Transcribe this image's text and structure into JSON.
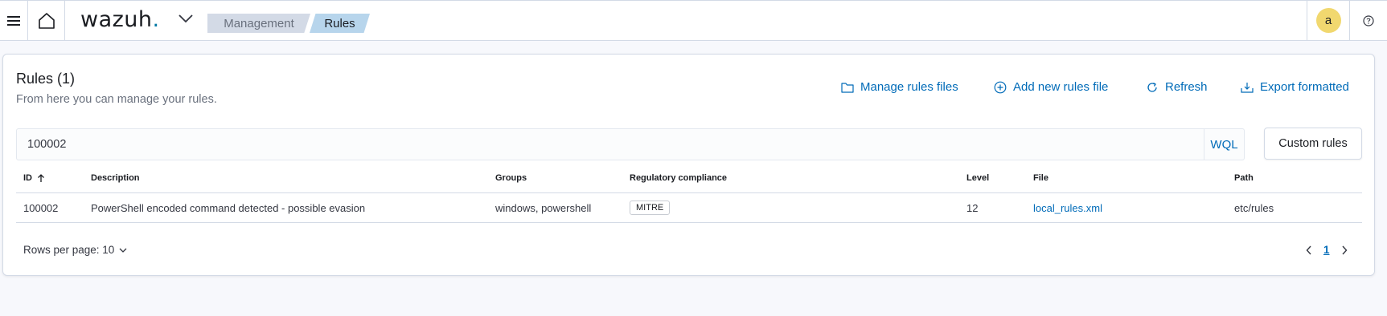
{
  "header": {
    "logo_text": "wazuh",
    "logo_dot": ".",
    "breadcrumbs": [
      "Management",
      "Rules"
    ],
    "user_initial": "a"
  },
  "panel": {
    "title": "Rules (1)",
    "subtitle": "From here you can manage your rules.",
    "actions": {
      "manage_rules_files": "Manage rules files",
      "add_new_rules_file": "Add new rules file",
      "refresh": "Refresh",
      "export_formatted": "Export formatted"
    },
    "search": {
      "value": "100002",
      "mode_label": "WQL"
    },
    "custom_rules_button": "Custom rules"
  },
  "table": {
    "columns": [
      "ID",
      "Description",
      "Groups",
      "Regulatory compliance",
      "Level",
      "File",
      "Path"
    ],
    "rows": [
      {
        "id": "100002",
        "description": "PowerShell encoded command detected - possible evasion",
        "groups": "windows, powershell",
        "compliance": "MITRE",
        "level": "12",
        "file": "local_rules.xml",
        "path": "etc/rules"
      }
    ]
  },
  "pagination": {
    "rows_per_page": "Rows per page: 10",
    "current_page": "1"
  },
  "colors": {
    "accent": "#006bb8",
    "avatar": "#f1d86f",
    "crumb_active": "#b7d5ec",
    "crumb_inactive": "#d3dae6"
  }
}
